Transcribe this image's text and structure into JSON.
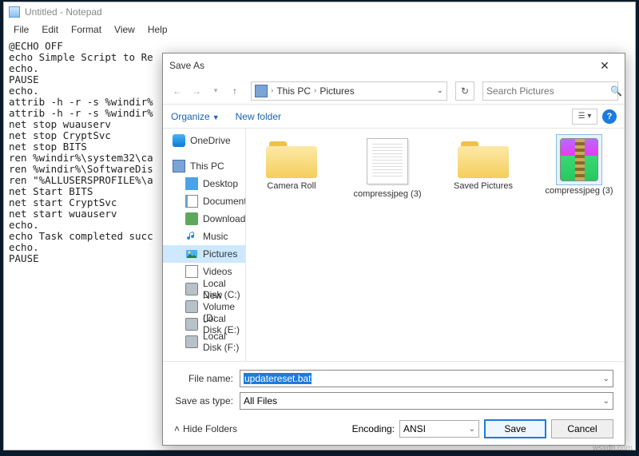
{
  "notepad": {
    "title": "Untitled - Notepad",
    "menu": {
      "file": "File",
      "edit": "Edit",
      "format": "Format",
      "view": "View",
      "help": "Help"
    },
    "content": "@ECHO OFF\necho Simple Script to Re\necho.\nPAUSE\necho.\nattrib -h -r -s %windir%\nattrib -h -r -s %windir%\nnet stop wuauserv\nnet stop CryptSvc\nnet stop BITS\nren %windir%\\system32\\ca\nren %windir%\\SoftwareDis\nren \"%ALLUSERSPROFILE%\\a\nnet Start BITS\nnet start CryptSvc\nnet start wuauserv\necho.\necho Task completed succ\necho.\nPAUSE"
  },
  "saveas": {
    "title": "Save As",
    "breadcrumb": {
      "root": "This PC",
      "folder": "Pictures"
    },
    "search_placeholder": "Search Pictures",
    "toolbar": {
      "organize": "Organize",
      "newfolder": "New folder"
    },
    "tree": {
      "onedrive": "OneDrive",
      "thispc": "This PC",
      "desktop": "Desktop",
      "documents": "Documents",
      "downloads": "Downloads",
      "music": "Music",
      "pictures": "Pictures",
      "videos": "Videos",
      "localc": "Local Disk (C:)",
      "newvol": "New Volume (D:",
      "locale": "Local Disk (E:)",
      "localf": "Local Disk (F:)"
    },
    "files": {
      "f1": "Camera Roll",
      "f2": "compressjpeg (3)",
      "f3": "Saved Pictures",
      "f4": "compressjpeg (3)"
    },
    "labels": {
      "filename": "File name:",
      "saveastype": "Save as type:",
      "encoding": "Encoding:",
      "hidefolders": "Hide Folders",
      "save": "Save",
      "cancel": "Cancel"
    },
    "values": {
      "filename": "updatereset.bat",
      "type": "All Files",
      "encoding": "ANSI"
    }
  },
  "watermark": "wsxdn.com"
}
